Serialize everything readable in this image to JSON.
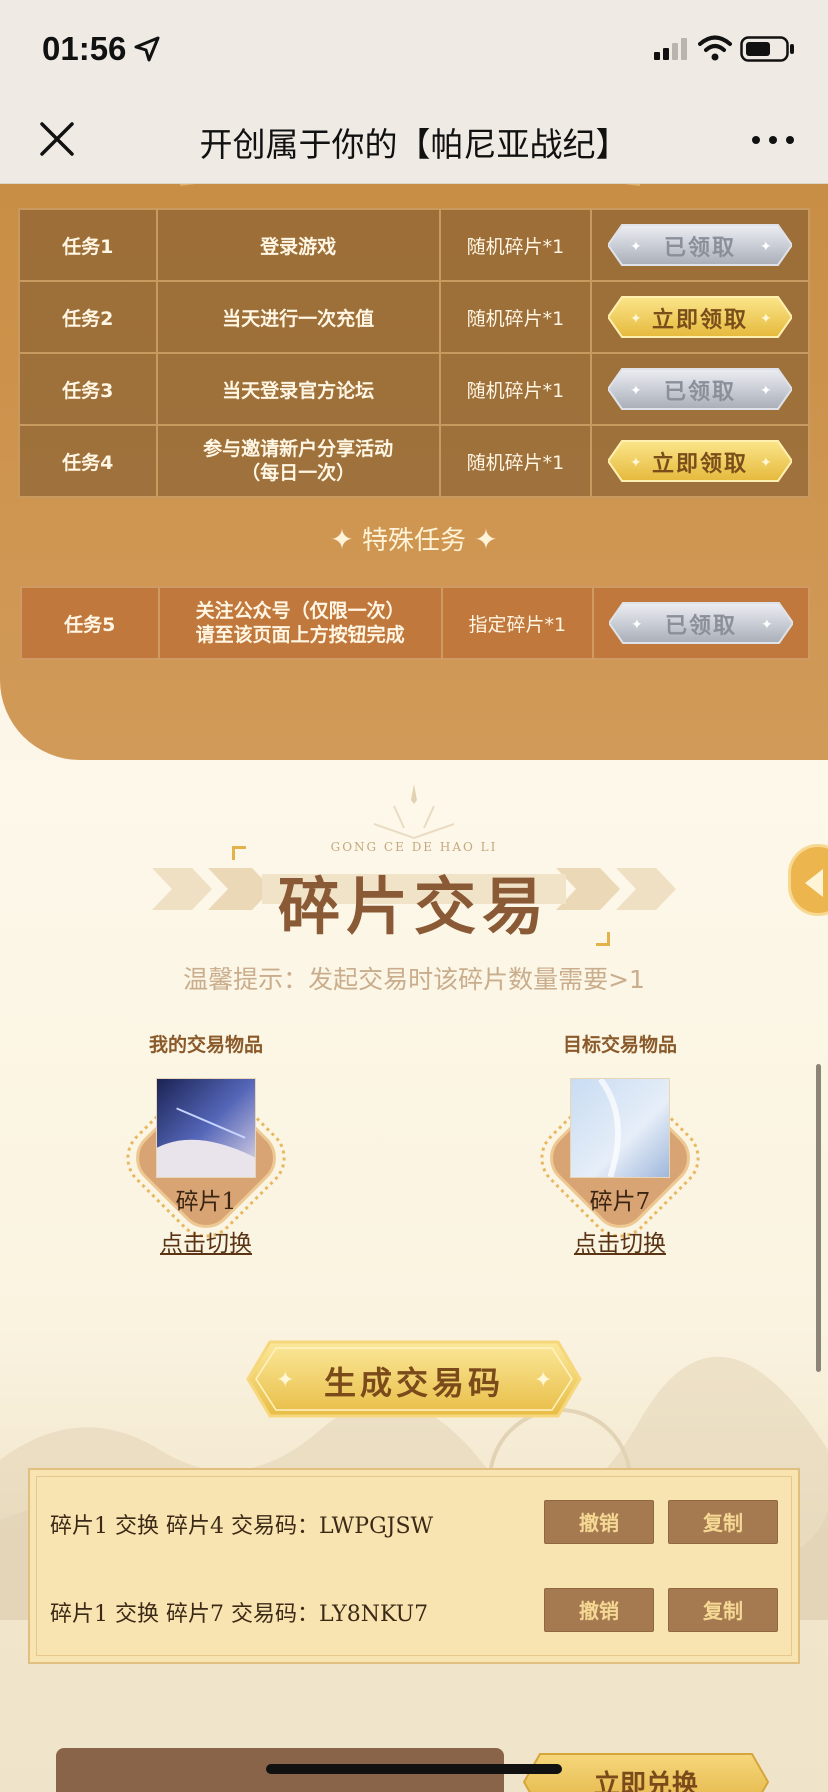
{
  "status": {
    "time": "01:56"
  },
  "nav": {
    "title": "开创属于你的【帕尼亚战纪】"
  },
  "tasks": [
    {
      "id": "任务1",
      "desc": "登录游戏",
      "reward": "随机碎片*1",
      "button": "已领取",
      "state": "claimed"
    },
    {
      "id": "任务2",
      "desc": "当天进行一次充值",
      "reward": "随机碎片*1",
      "button": "立即领取",
      "state": "active"
    },
    {
      "id": "任务3",
      "desc": "当天登录官方论坛",
      "reward": "随机碎片*1",
      "button": "已领取",
      "state": "claimed"
    },
    {
      "id": "任务4",
      "desc_line1": "参与邀请新户分享活动",
      "desc_line2": "（每日一次）",
      "reward": "随机碎片*1",
      "button": "立即领取",
      "state": "active"
    }
  ],
  "special": {
    "title": "特殊任务",
    "task": {
      "id": "任务5",
      "desc_line1": "关注公众号（仅限一次）",
      "desc_line2": "请至该页面上方按钮完成",
      "reward": "指定碎片*1",
      "button": "已领取",
      "state": "claimed"
    }
  },
  "trade": {
    "subtitle": "GONG CE DE HAO LI",
    "title": "碎片交易",
    "tip": "温馨提示：发起交易时该碎片数量需要>1",
    "my_item": {
      "label": "我的交易物品",
      "name": "碎片1",
      "switch": "点击切换"
    },
    "target_item": {
      "label": "目标交易物品",
      "name": "碎片7",
      "switch": "点击切换"
    },
    "generate_button": "生成交易码",
    "codes": [
      {
        "text": "碎片1 交换 碎片4 交易码：LWPGJSW",
        "cancel": "撤销",
        "copy": "复制"
      },
      {
        "text": "碎片1 交换 碎片7 交易码：LY8NKU7",
        "cancel": "撤销",
        "copy": "复制"
      }
    ],
    "bottom_button": "立即兑换"
  },
  "colors": {
    "task_bg": "#c98e45",
    "accent_gold": "#f0c955",
    "trade_bg": "#fbf6e8",
    "code_panel": "#f8e4b0",
    "code_button": "#a57a50"
  }
}
